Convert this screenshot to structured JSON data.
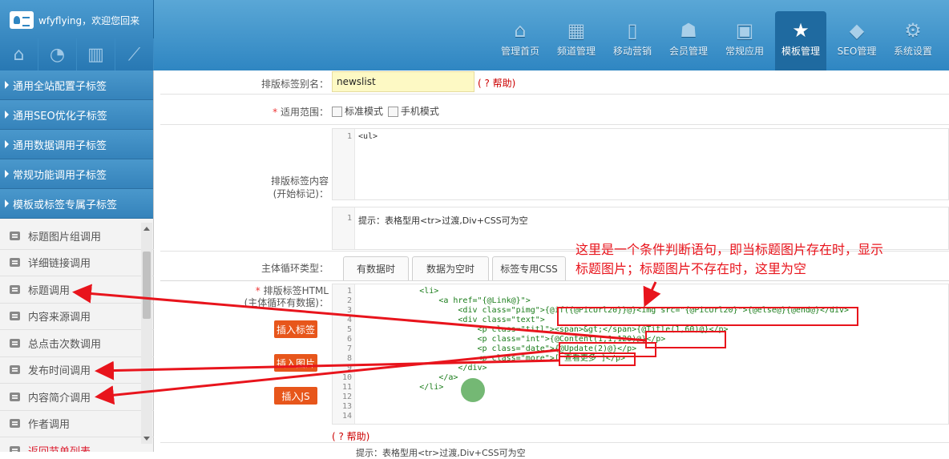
{
  "header": {
    "username_text": "wfyflying，欢迎您回来",
    "tools": [
      "home-tool-icon",
      "pie-chart-icon",
      "trash-icon",
      "line-chart-icon"
    ],
    "nav": [
      {
        "label": "管理首页",
        "icon": "⌂",
        "active": false
      },
      {
        "label": "频道管理",
        "icon": "▦",
        "active": false
      },
      {
        "label": "移动营销",
        "icon": "▯",
        "active": false
      },
      {
        "label": "会员管理",
        "icon": "☗",
        "active": false
      },
      {
        "label": "常规应用",
        "icon": "▣",
        "active": false
      },
      {
        "label": "模板管理",
        "icon": "★",
        "active": true
      },
      {
        "label": "SEO管理",
        "icon": "◆",
        "active": false
      },
      {
        "label": "系统设置",
        "icon": "⚙",
        "active": false
      }
    ]
  },
  "sidebar": {
    "groups": [
      "通用全站配置子标签",
      "通用SEO优化子标签",
      "通用数据调用子标签",
      "常规功能调用子标签",
      "模板或标签专属子标签"
    ],
    "items": [
      "标题图片组调用",
      "详细链接调用",
      "标题调用",
      "内容来源调用",
      "总点击次数调用",
      "发布时间调用",
      "内容简介调用",
      "作者调用",
      "返回节单列表"
    ]
  },
  "form": {
    "alias_label": "排版标签别名：",
    "alias_value": "newslist",
    "help_text": "( ? 帮助)",
    "scope_label": "适用范围：",
    "scope_standard": "标准模式",
    "scope_mobile": "手机模式",
    "content_label_1": "排版标签内容",
    "content_label_2": "(开始标记)：",
    "editor1_line": "1",
    "editor1_code": "<ul>",
    "editor2_line": "1",
    "editor2_code": "提示：表格型用<tr>过渡,Div+CSS可为空",
    "loop_label": "主体循环类型：",
    "tabs": [
      "有数据时",
      "数据为空时",
      "标签专用CSS"
    ],
    "html_label_1": "排版标签HTML",
    "html_label_2": "(主体循环有数据)：",
    "btn_insert_tag": "插入标签",
    "btn_insert_image": "插入图片",
    "btn_insert_js": "插入JS",
    "help_text_2": "( ? 帮助)",
    "bottom_hint": "提示：表格型用<tr>过渡,Div+CSS可为空"
  },
  "code_lines": [
    {
      "n": "1",
      "text": "            <li>"
    },
    {
      "n": "2",
      "text": "                <a href=\"{@Link@}\">"
    },
    {
      "n": "3",
      "text": "                    <div class=\"pimg\">{@if({@PicUrl20}}@}<img src=\"{@PicUrl20}\">{@else@}{@end@}</div>"
    },
    {
      "n": "4",
      "text": "                    <div class=\"text\">"
    },
    {
      "n": "5",
      "text": "                        <p class=\"titl\"><span>&gt;</span>{@Title(1,60)@}</p>"
    },
    {
      "n": "6",
      "text": "                        <p class=\"int\">{@Content(1,1,120)@}</p>"
    },
    {
      "n": "7",
      "text": "                        <p class=\"date\">{@Update(2)@}</p>"
    },
    {
      "n": "8",
      "text": "                        <p class=\"more\">[ 查看更多 ]</p>"
    },
    {
      "n": "9",
      "text": "                    </div>"
    },
    {
      "n": "10",
      "text": "                </a>"
    },
    {
      "n": "11",
      "text": "            </li>"
    },
    {
      "n": "12",
      "text": ""
    },
    {
      "n": "13",
      "text": ""
    },
    {
      "n": "14",
      "text": ""
    }
  ],
  "annotation": {
    "line1": "这里是一个条件判断语句，即当标题图片存在时，显示",
    "line2": "标题图片；标题图片不存在时，这里为空"
  },
  "colors": {
    "accent": "#2f86c2",
    "annotation": "#e8141c",
    "button": "#e7561b"
  }
}
